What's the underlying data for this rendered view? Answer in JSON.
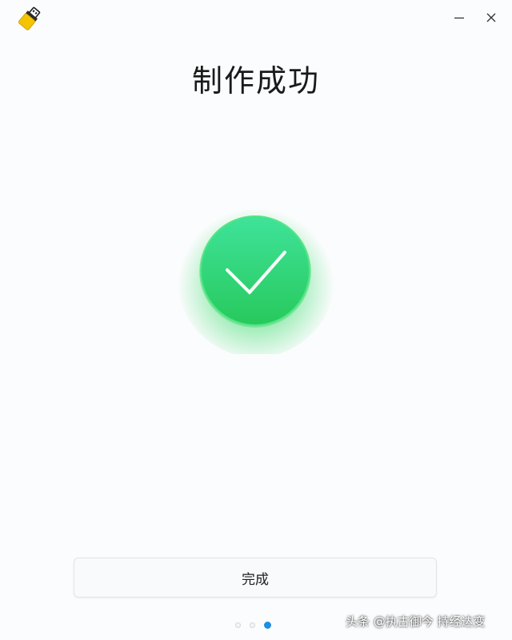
{
  "window": {
    "app_icon": "usb-drive-icon",
    "controls": {
      "minimize_icon": "minimize-icon",
      "close_icon": "close-icon"
    }
  },
  "main": {
    "title": "制作成功",
    "status_icon": "checkmark-circle-icon",
    "done_label": "完成"
  },
  "pager": {
    "total_steps": 3,
    "current_step": 3
  },
  "watermark": {
    "text": "头条 @执古御今 持经达变"
  },
  "colors": {
    "success_green_light": "#3fe39a",
    "success_green": "#27c95c",
    "accent_blue": "#1e8fe0",
    "icon_yellow": "#f5c400"
  }
}
